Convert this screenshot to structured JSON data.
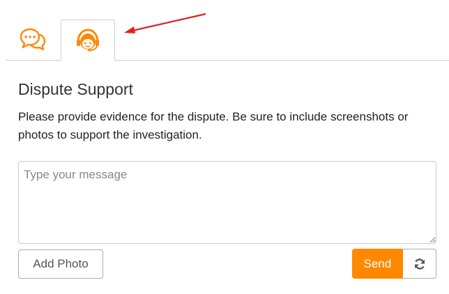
{
  "colors": {
    "accent": "#ff8800",
    "annotation_arrow": "#e02020",
    "border": "#cccccc"
  },
  "tabs": [
    {
      "icon": "chat-bubbles-icon",
      "active": false
    },
    {
      "icon": "support-agent-icon",
      "active": true
    }
  ],
  "content": {
    "title": "Dispute Support",
    "description": "Please provide evidence for the dispute. Be sure to include screenshots or photos to support the investigation."
  },
  "message": {
    "placeholder": "Type your message",
    "value": ""
  },
  "buttons": {
    "add_photo": "Add Photo",
    "send": "Send",
    "refresh_icon": "refresh-icon"
  }
}
